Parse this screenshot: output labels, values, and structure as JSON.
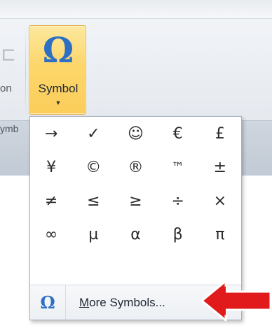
{
  "ribbon": {
    "partial_label": "on",
    "partial_group": "ymb"
  },
  "symbol_button": {
    "glyph": "Ω",
    "label": "Symbol",
    "caret": "▼"
  },
  "symbols": [
    "→",
    "✓",
    "☺",
    "€",
    "£",
    "¥",
    "©",
    "®",
    "™",
    "±",
    "≠",
    "≤",
    "≥",
    "÷",
    "×",
    "∞",
    "µ",
    "α",
    "β",
    "π"
  ],
  "more_symbols": {
    "glyph": "Ω",
    "mnemonic": "M",
    "label_rest": "ore Symbols..."
  },
  "colors": {
    "accent_blue": "#2d6fc4",
    "highlight": "#fdd66a",
    "arrow_red": "#e11b1b"
  },
  "icons": {
    "callout": "red-arrow-icon"
  }
}
